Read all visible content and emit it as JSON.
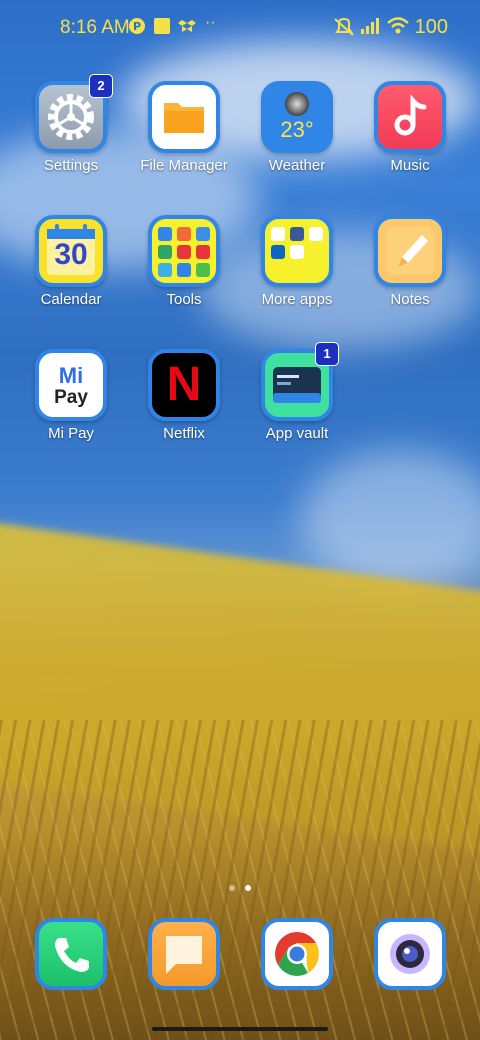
{
  "status_bar": {
    "time": "8:16 AM",
    "battery": "100"
  },
  "apps": [
    {
      "label": "Settings",
      "icon": "gear-icon",
      "badge": "2"
    },
    {
      "label": "File Manager",
      "icon": "folder-icon"
    },
    {
      "label": "Weather",
      "icon": "moon-icon",
      "temp": "23°"
    },
    {
      "label": "Music",
      "icon": "music-note-icon"
    },
    {
      "label": "Calendar",
      "icon": "calendar-icon",
      "day": "30"
    },
    {
      "label": "Tools",
      "icon": "tools-folder-icon"
    },
    {
      "label": "More apps",
      "icon": "apps-folder-icon"
    },
    {
      "label": "Notes",
      "icon": "pencil-icon"
    },
    {
      "label": "Mi Pay",
      "icon": "mi-pay-icon",
      "logo_top": "Mi",
      "logo_bottom": "Pay"
    },
    {
      "label": "Netflix",
      "icon": "netflix-icon",
      "logo": "N"
    },
    {
      "label": "App vault",
      "icon": "app-vault-icon",
      "badge": "1"
    }
  ],
  "dock": [
    {
      "name": "phone-icon"
    },
    {
      "name": "messages-icon"
    },
    {
      "name": "chrome-icon"
    },
    {
      "name": "camera-icon"
    }
  ],
  "colors": {
    "status_text": "#f4e14a",
    "icon_border": "#2f86e6",
    "badge": "#1d2fbf"
  }
}
